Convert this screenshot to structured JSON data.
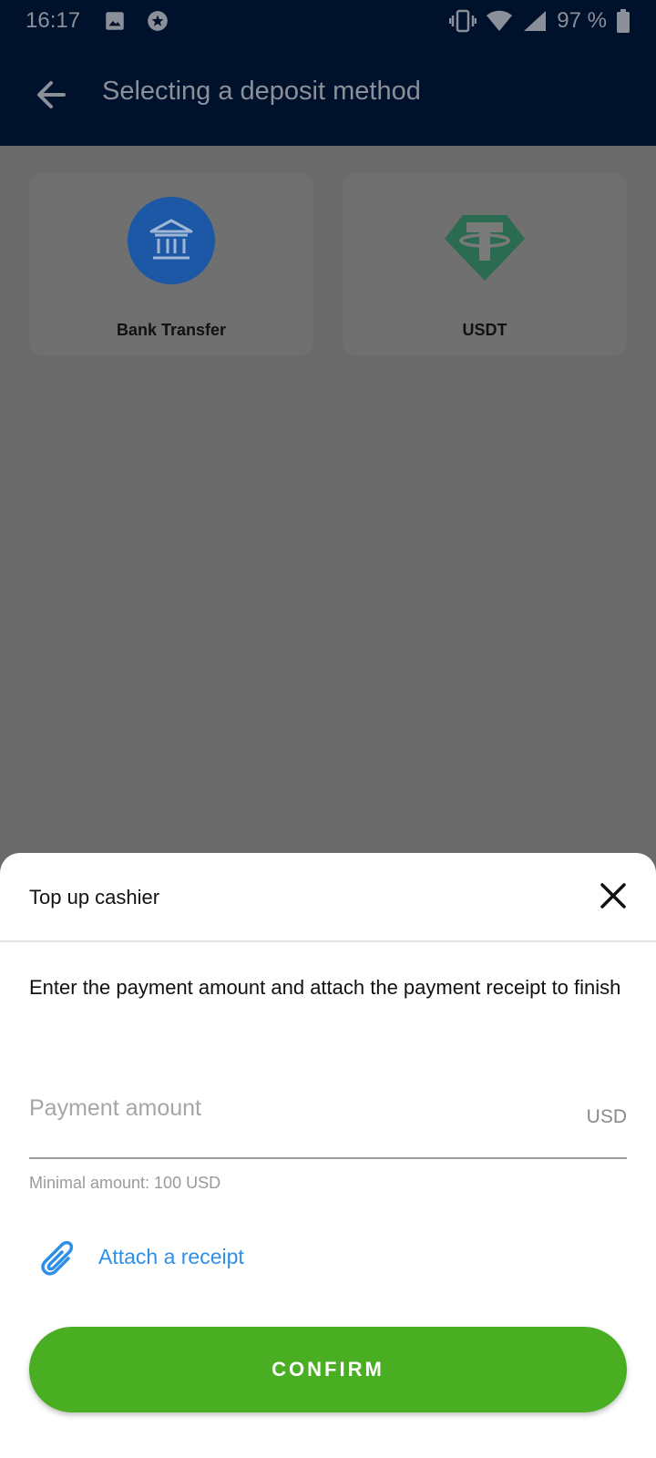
{
  "status_bar": {
    "time": "16:17",
    "battery": "97 %",
    "icons": [
      "image-icon",
      "star-badge-icon",
      "vibrate-icon",
      "wifi-icon",
      "signal-icon",
      "battery-icon"
    ]
  },
  "app_bar": {
    "title": "Selecting a deposit method",
    "back_icon": "arrow-back-icon"
  },
  "methods": [
    {
      "label": "Bank Transfer",
      "icon": "bank-icon",
      "color": "#1d58a6"
    },
    {
      "label": "USDT",
      "icon": "tether-icon",
      "color": "#2b6b52"
    }
  ],
  "sheet": {
    "title": "Top up cashier",
    "description": "Enter the payment amount and attach the payment receipt to finish",
    "amount_placeholder": "Payment amount",
    "amount_value": "",
    "currency": "USD",
    "min_hint": "Minimal amount: 100 USD",
    "attach_label": "Attach a receipt",
    "confirm_label": "CONFIRM"
  },
  "colors": {
    "header_bg": "#00112c",
    "overlay": "#6a6a6a",
    "accent_blue": "#2f8fe6",
    "confirm_green": "#4aae23"
  }
}
